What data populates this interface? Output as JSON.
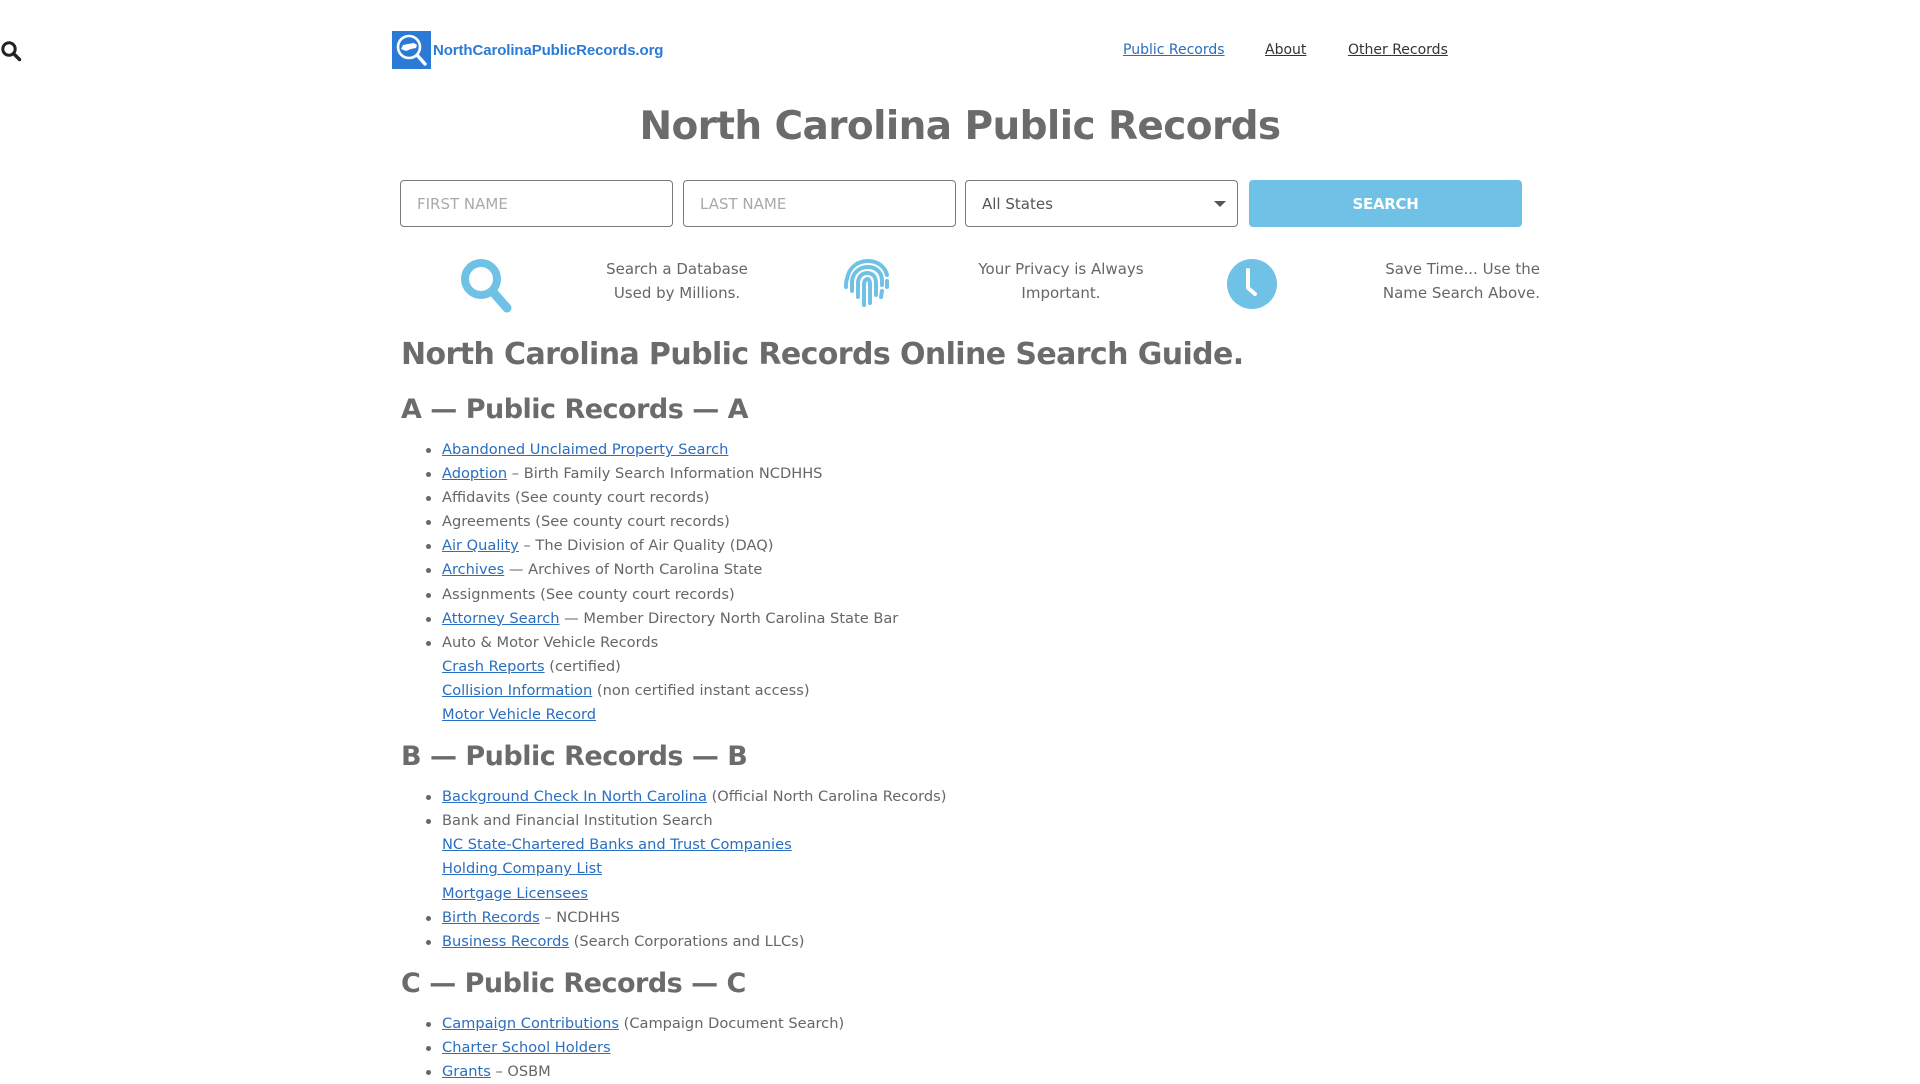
{
  "header": {
    "logo_text": "NorthCarolinaPublicRecords.org",
    "logo_icon": "magnifier-north-carolina-icon",
    "brand_color": "#2b7bd6",
    "nav": [
      {
        "label": "Public Records",
        "active": true
      },
      {
        "label": "About",
        "active": false
      },
      {
        "label": "Other Records",
        "active": false
      }
    ],
    "search_icon": "search-icon"
  },
  "hero": {
    "title": "North Carolina Public Records",
    "form": {
      "first_name": {
        "value": "",
        "placeholder": "FIRST NAME"
      },
      "last_name": {
        "value": "",
        "placeholder": "LAST NAME"
      },
      "state": {
        "selected": "All States"
      },
      "submit_label": "SEARCH"
    },
    "accent_color": "#6fc1e6",
    "features": [
      {
        "icon": "search-icon",
        "line1": "Search a Database",
        "line2": "Used by Millions."
      },
      {
        "icon": "fingerprint-icon",
        "line1": "Your Privacy is Always",
        "line2": "Important."
      },
      {
        "icon": "clock-icon",
        "line1": "Save Time... Use the",
        "line2": "Name Search Above."
      }
    ]
  },
  "guide": {
    "title": "North Carolina Public Records Online Search Guide.",
    "link_color": "#2a6ebf",
    "sections": [
      {
        "heading": "A — Public Records — A",
        "items": [
          {
            "link": "Abandoned Unclaimed Property Search",
            "text": "",
            "bullet": true
          },
          {
            "link": "Adoption",
            "text": " – Birth Family Search Information NCDHHS",
            "bullet": true
          },
          {
            "link": "",
            "text": "Affidavits (See county court records)",
            "bullet": true
          },
          {
            "link": "",
            "text": "Agreements (See county court records)",
            "bullet": true
          },
          {
            "link": "Air Quality",
            "text": " – The Division of Air Quality (DAQ)",
            "bullet": true
          },
          {
            "link": "Archives",
            "text": " — Archives of North Carolina State",
            "bullet": true
          },
          {
            "link": "",
            "text": "Assignments (See county court records)",
            "bullet": true
          },
          {
            "link": "Attorney Search",
            "text": " — Member Directory North Carolina State Bar",
            "bullet": true
          },
          {
            "link": "",
            "text": "Auto & Motor Vehicle Records",
            "bullet": true
          },
          {
            "link": "Crash Reports",
            "text": " (certified)",
            "bullet": false
          },
          {
            "link": "Collision Information",
            "text": " (non certified instant access)",
            "bullet": false
          },
          {
            "link": "Motor Vehicle Record",
            "text": "",
            "bullet": false
          }
        ]
      },
      {
        "heading": "B — Public Records — B",
        "items": [
          {
            "link": "Background Check In North Carolina",
            "text": " (Official North Carolina Records)",
            "bullet": true
          },
          {
            "link": "",
            "text": "Bank and Financial Institution Search",
            "bullet": true
          },
          {
            "link": "NC State-Chartered Banks and Trust Companies",
            "text": "",
            "bullet": false
          },
          {
            "link": "Holding Company List",
            "text": "",
            "bullet": false
          },
          {
            "link": "Mortgage Licensees",
            "text": "",
            "bullet": false
          },
          {
            "link": "Birth Records",
            "text": " – NCDHHS",
            "bullet": true
          },
          {
            "link": "Business Records",
            "text": " (Search Corporations and LLCs)",
            "bullet": true
          }
        ]
      },
      {
        "heading": "C — Public Records — C",
        "items": [
          {
            "link": "Campaign Contributions",
            "text": " (Campaign Document Search)",
            "bullet": true
          },
          {
            "link": "Charter School Holders",
            "text": "",
            "bullet": true
          },
          {
            "link": "Grants",
            "text": " – OSBM",
            "bullet": true
          }
        ]
      }
    ]
  }
}
